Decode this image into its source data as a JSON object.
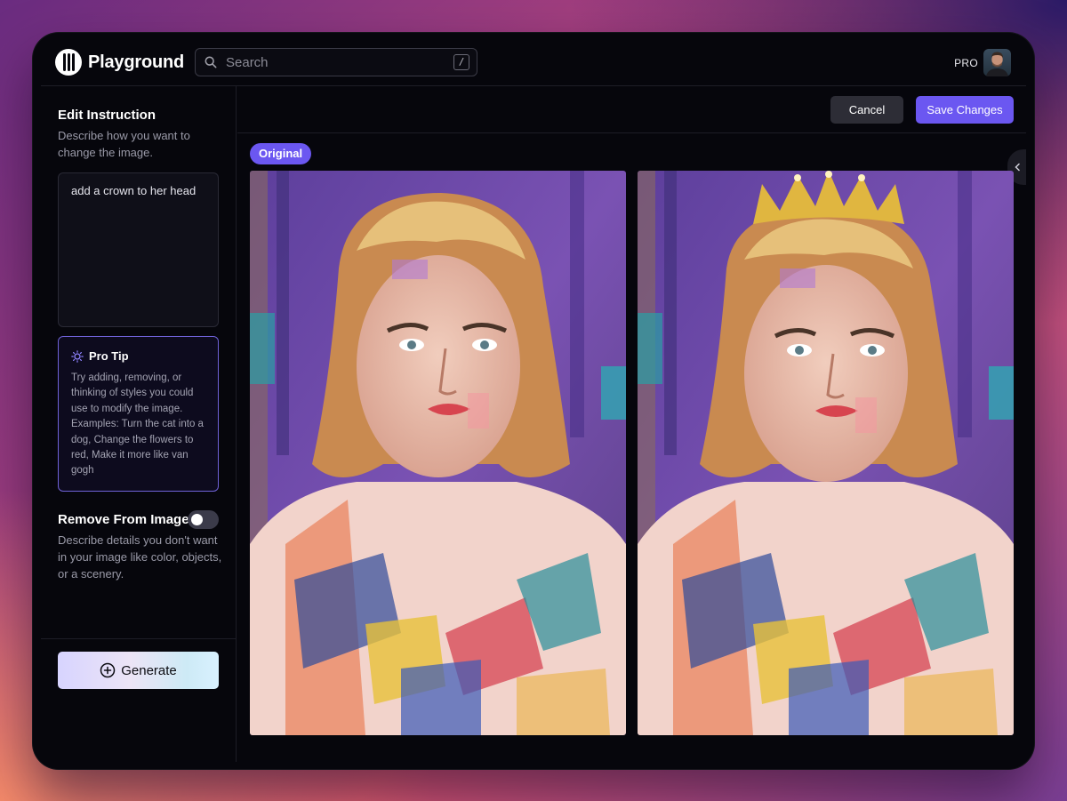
{
  "app": {
    "name": "Playground"
  },
  "search": {
    "placeholder": "Search",
    "shortcut": "/"
  },
  "user": {
    "plan": "PRO"
  },
  "sidebar": {
    "edit_title": "Edit Instruction",
    "edit_description": "Describe how you want to change the image.",
    "instruction_value": "add a crown to her head",
    "tip": {
      "title": "Pro Tip",
      "body": "Try adding, removing, or thinking of styles you could use to modify the image. Examples: Turn the cat into a dog, Change the flowers to red, Make it more like van gogh"
    },
    "remove": {
      "title": "Remove From Image",
      "toggle_on": false,
      "description": "Describe details you don't want in your image like color, objects, or a scenery."
    },
    "generate_label": "Generate"
  },
  "toolbar": {
    "cancel_label": "Cancel",
    "save_label": "Save Changes"
  },
  "main": {
    "original_badge": "Original"
  },
  "colors": {
    "accent": "#6b57f1",
    "background": "#06060c",
    "tip_border": "#6f62d8"
  },
  "icons": {
    "search": "search-icon",
    "tip": "lightbulb-icon",
    "generate": "plus-circle-icon",
    "collapse": "chevron-left-icon"
  }
}
